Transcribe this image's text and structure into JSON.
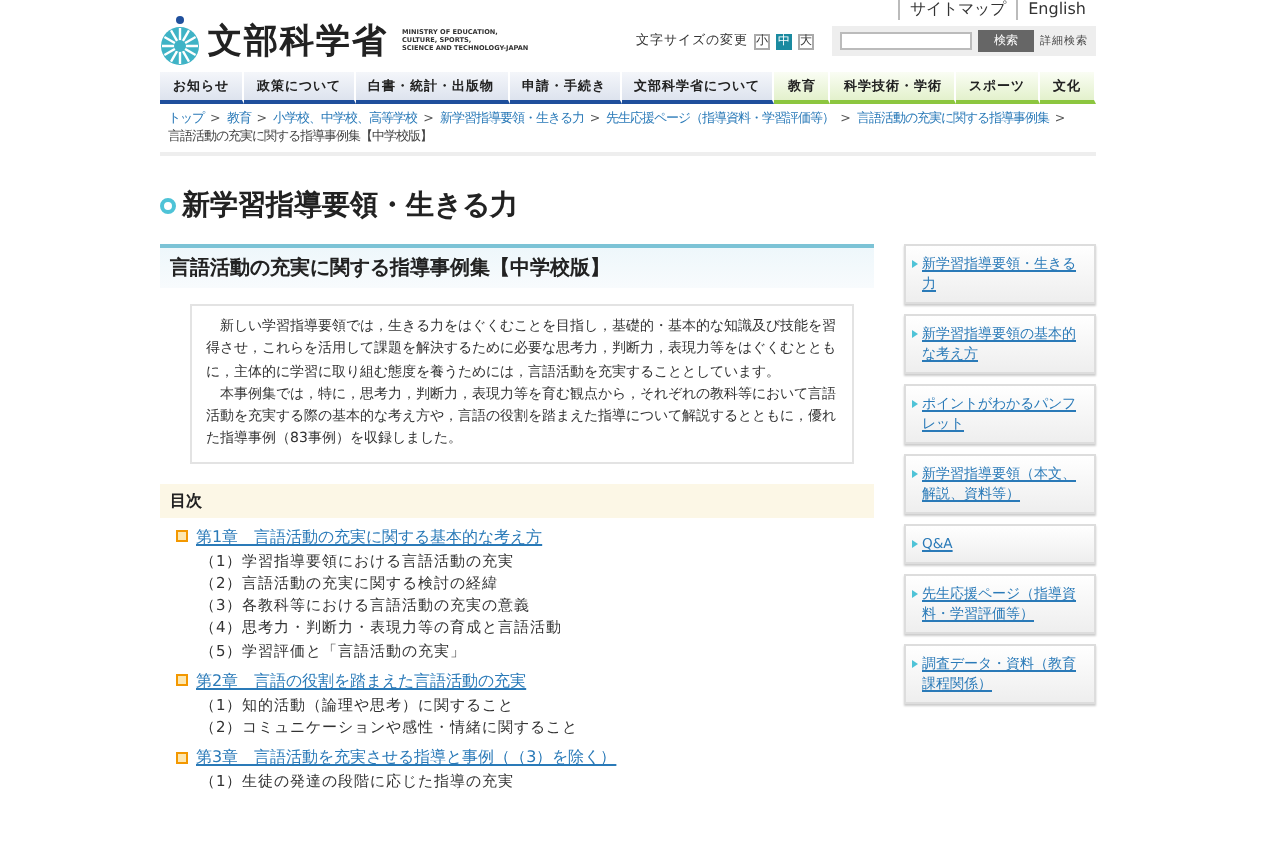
{
  "header": {
    "logo_text": "文部科学省",
    "logo_subtext": [
      "MINISTRY OF EDUCATION,",
      "CULTURE, SPORTS,",
      "SCIENCE AND TECHNOLOGY-JAPAN"
    ],
    "top_links": [
      "サイトマップ",
      "English"
    ],
    "font_size": {
      "label": "文字サイズの変更",
      "options": [
        {
          "label": "小",
          "selected": false
        },
        {
          "label": "中",
          "selected": true
        },
        {
          "label": "大",
          "selected": false
        }
      ]
    },
    "search": {
      "button": "検索",
      "advanced": "詳細検索"
    }
  },
  "nav": [
    {
      "label": "お知らせ",
      "kind": "ministry"
    },
    {
      "label": "政策について",
      "kind": "ministry"
    },
    {
      "label": "白書・統計・出版物",
      "kind": "ministry"
    },
    {
      "label": "申請・手続き",
      "kind": "ministry"
    },
    {
      "label": "文部科学省について",
      "kind": "ministry"
    },
    {
      "label": "教育",
      "kind": "field"
    },
    {
      "label": "科学技術・学術",
      "kind": "field"
    },
    {
      "label": "スポーツ",
      "kind": "field"
    },
    {
      "label": "文化",
      "kind": "field"
    }
  ],
  "breadcrumb": [
    {
      "label": "トップ",
      "link": true
    },
    {
      "sep": ">",
      "label": "教育",
      "link": true
    },
    {
      "sep": ">",
      "label": "小学校、中学校、高等学校",
      "link": true
    },
    {
      "sep": ">",
      "label": "新学習指導要領・生きる力",
      "link": true
    },
    {
      "sep": ">",
      "label": "先生応援ページ（指導資料・学習評価等）",
      "link": true
    },
    {
      "sep": ">",
      "label": "言語活動の充実に関する指導事例集",
      "link": true
    },
    {
      "sep": ">",
      "label": "言語活動の充実に関する指導事例集【中学校版】",
      "link": false
    }
  ],
  "page_title": "新学習指導要領・生きる力",
  "section_title": "言語活動の充実に関する指導事例集【中学校版】",
  "intro": [
    "新しい学習指導要領では，生きる力をはぐくむことを目指し，基礎的・基本的な知識及び技能を習得させ，これらを活用して課題を解決するために必要な思考力，判断力，表現力等をはぐくむとともに，主体的に学習に取り組む態度を養うためには，言語活動を充実することとしています。",
    "本事例集では，特に，思考力，判断力，表現力等を育む観点から，それぞれの教科等において言語活動を充実する際の基本的な考え方や，言語の役割を踏まえた指導について解説するとともに，優れた指導事例（83事例）を収録しました。"
  ],
  "toc": {
    "title": "目次",
    "chapters": [
      {
        "title": "第1章　言語活動の充実に関する基本的な考え方",
        "items": [
          "（1）学習指導要領における言語活動の充実",
          "（2）言語活動の充実に関する検討の経緯",
          "（3）各教科等における言語活動の充実の意義",
          "（4）思考力・判断力・表現力等の育成と言語活動",
          "（5）学習評価と「言語活動の充実」"
        ]
      },
      {
        "title": "第2章　言語の役割を踏まえた言語活動の充実",
        "items": [
          "（1）知的活動（論理や思考）に関すること",
          "（2）コミュニケーションや感性・情緒に関すること"
        ]
      },
      {
        "title": "第3章　言語活動を充実させる指導と事例（（3）を除く）",
        "items": [
          "（1）生徒の発達の段階に応じた指導の充実"
        ]
      }
    ]
  },
  "sidebar": [
    "新学習指導要領・生きる力",
    "新学習指導要領の基本的な考え方",
    "ポイントがわかるパンフレット",
    "新学習指導要領（本文、解説、資料等）",
    "Q&A",
    "先生応援ページ（指導資料・学習評価等）",
    "調査データ・資料（教育課程関係）"
  ]
}
